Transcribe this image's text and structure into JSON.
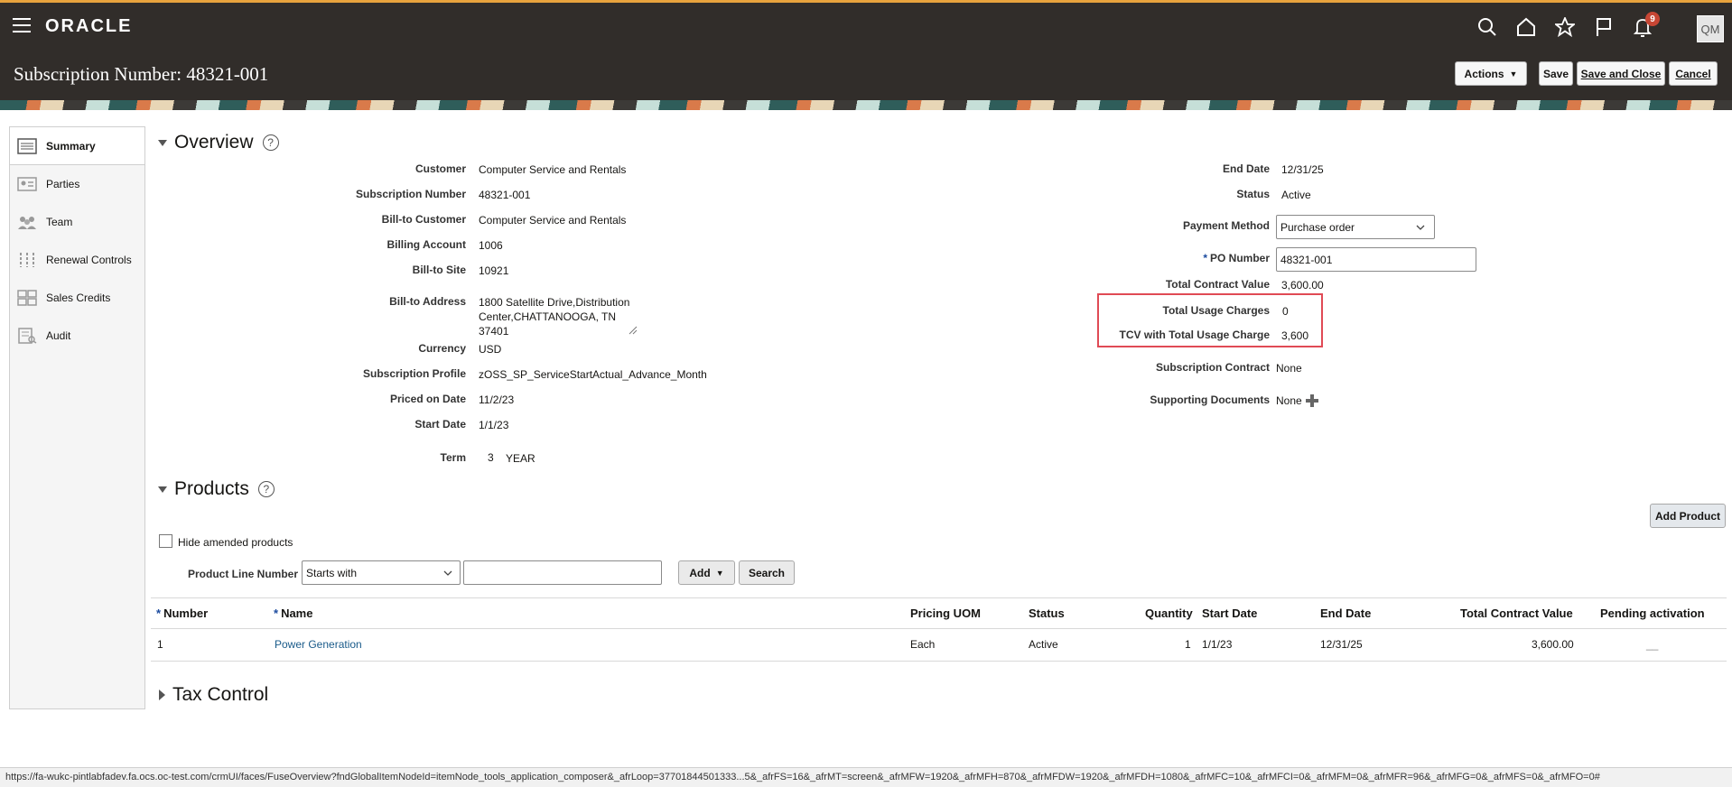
{
  "app": {
    "logo": "ORACLE",
    "notification_count": "9",
    "user_initials": "QM"
  },
  "header": {
    "title": "Subscription Number: 48321-001",
    "actions_label": "Actions",
    "save_label": "Save",
    "save_close_label": "Save and Close",
    "cancel_label": "Cancel"
  },
  "nav": {
    "items": [
      {
        "label": "Summary",
        "icon": "list-icon"
      },
      {
        "label": "Parties",
        "icon": "parties-icon"
      },
      {
        "label": "Team",
        "icon": "team-icon"
      },
      {
        "label": "Renewal Controls",
        "icon": "renewal-icon"
      },
      {
        "label": "Sales Credits",
        "icon": "sales-credits-icon"
      },
      {
        "label": "Audit",
        "icon": "audit-icon"
      }
    ]
  },
  "overview": {
    "title": "Overview",
    "left": {
      "customer_label": "Customer",
      "customer": "Computer Service and Rentals",
      "subnum_label": "Subscription Number",
      "subnum": "48321-001",
      "billto_customer_label": "Bill-to Customer",
      "billto_customer": "Computer Service and Rentals",
      "billing_account_label": "Billing Account",
      "billing_account": "1006",
      "billto_site_label": "Bill-to Site",
      "billto_site": "10921",
      "billto_address_label": "Bill-to Address",
      "billto_address_1": "1800 Satellite Drive,Distribution",
      "billto_address_2": "Center,CHATTANOOGA, TN",
      "billto_address_3": "37401",
      "currency_label": "Currency",
      "currency": "USD",
      "profile_label": "Subscription Profile",
      "profile": "zOSS_SP_ServiceStartActual_Advance_Month",
      "priced_label": "Priced on Date",
      "priced": "11/2/23",
      "start_label": "Start Date",
      "start": "1/1/23",
      "term_label": "Term",
      "term_value": "3",
      "term_unit": "YEAR"
    },
    "right": {
      "end_label": "End Date",
      "end": "12/31/25",
      "status_label": "Status",
      "status": "Active",
      "payment_label": "Payment Method",
      "payment": "Purchase order",
      "po_label": "PO Number",
      "po": "48321-001",
      "tcv_label": "Total Contract Value",
      "tcv": "3,600.00",
      "usage_label": "Total Usage Charges",
      "usage": "0",
      "tcv_usage_label": "TCV with Total Usage Charge",
      "tcv_usage": "3,600",
      "contract_label": "Subscription Contract",
      "contract": "None",
      "docs_label": "Supporting Documents",
      "docs": "None"
    }
  },
  "products": {
    "title": "Products",
    "add_product_label": "Add Product",
    "hide_amended_label": "Hide amended products",
    "filter_label": "Product Line Number",
    "filter_operator": "Starts with",
    "filter_value": "",
    "add_label": "Add",
    "search_label": "Search",
    "columns": [
      "Number",
      "Name",
      "Pricing UOM",
      "Status",
      "Quantity",
      "Start Date",
      "End Date",
      "Total Contract Value",
      "Pending activation"
    ],
    "rows": [
      {
        "number": "1",
        "name": "Power Generation",
        "uom": "Each",
        "status": "Active",
        "quantity": "1",
        "start": "1/1/23",
        "end": "12/31/25",
        "tcv": "3,600.00",
        "pending": "__"
      }
    ]
  },
  "tax": {
    "title": "Tax Control"
  },
  "statusbar": {
    "url": "https://fa-wukc-pintlabfadev.fa.ocs.oc-test.com/crmUI/faces/FuseOverview?fndGlobalItemNodeId=itemNode_tools_application_composer&_afrLoop=37701844501333...5&_afrFS=16&_afrMT=screen&_afrMFW=1920&_afrMFH=870&_afrMFDW=1920&_afrMFDH=1080&_afrMFC=10&_afrMFCI=0&_afrMFM=0&_afrMFR=96&_afrMFG=0&_afrMFS=0&_afrMFO=0#"
  }
}
